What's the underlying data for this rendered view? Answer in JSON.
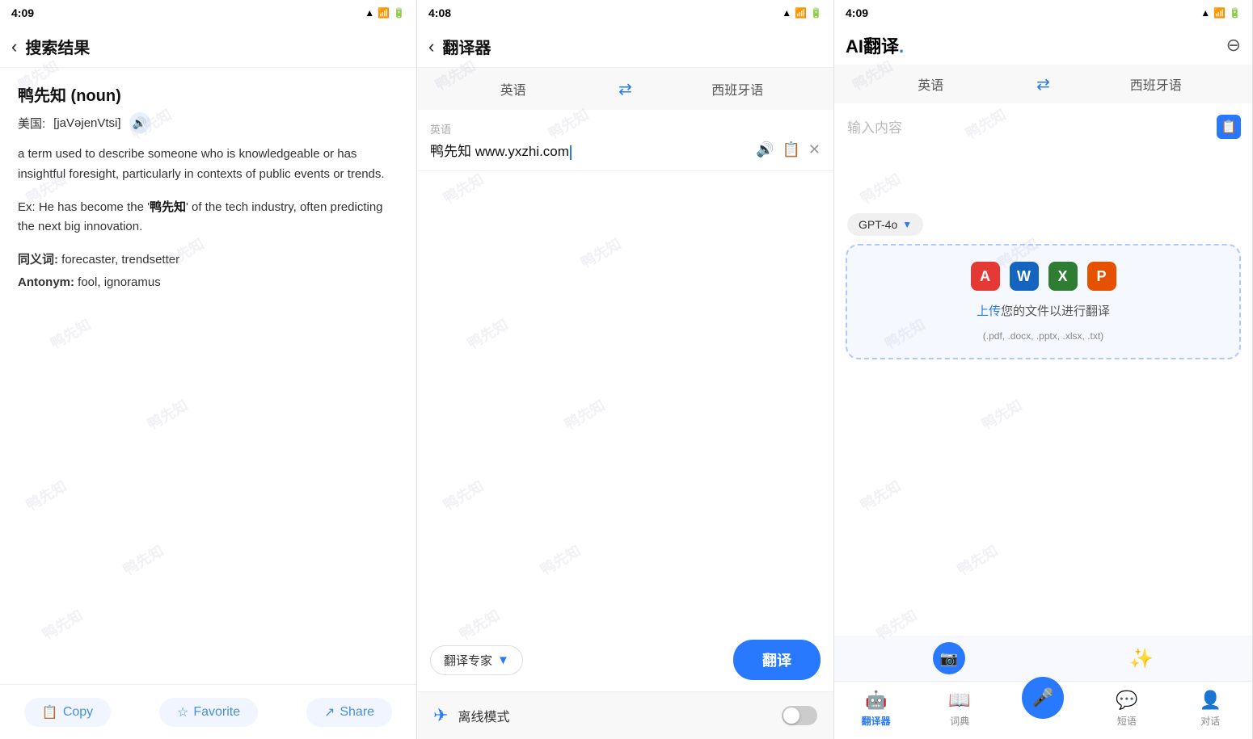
{
  "panel1": {
    "status_time": "4:09",
    "nav_back": "‹",
    "nav_title": "搜索结果",
    "word": "鸭先知 (noun)",
    "phonetic_label": "美国:",
    "phonetic": "[jaVəjenVtsi]",
    "definition": "a term used to describe someone who is knowledgeable or has insightful foresight, particularly in contexts of public events or trends.",
    "example_prefix": "Ex: He has become the '",
    "example_word": "鸭先知",
    "example_suffix": "' of the tech industry, often predicting the next big innovation.",
    "synonyms_label": "同义词:",
    "synonyms": "forecaster, trendsetter",
    "antonym_label": "Antonym:",
    "antonym": "fool, ignoramus",
    "action_copy": "Copy",
    "action_favorite": "Favorite",
    "action_share": "Share"
  },
  "panel2": {
    "status_time": "4:08",
    "nav_back": "‹",
    "nav_title": "翻译器",
    "lang_from": "英语",
    "lang_swap": "⇄",
    "lang_to": "西班牙语",
    "input_lang_label": "英语",
    "input_text": "鸭先知 www.yxzhi.com",
    "expert_label": "翻译专家",
    "translate_btn": "翻译",
    "offline_label": "离线模式"
  },
  "panel3": {
    "status_time": "4:09",
    "nav_title": "AI翻译",
    "nav_dot": ".",
    "close_icon": "⊖",
    "lang_from": "英语",
    "lang_swap": "⇄",
    "lang_to": "西班牙语",
    "placeholder": "输入内容",
    "model": "GPT-4o",
    "upload_link": "上传",
    "upload_text_mid": "您的文件以进行翻译",
    "upload_subtext": "(.pdf, .docx, .pptx, .xlsx, .txt)",
    "tabs": [
      {
        "icon": "🤖",
        "label": "翻译器",
        "active": true
      },
      {
        "icon": "📖",
        "label": "词典",
        "active": false
      },
      {
        "icon": "💬",
        "label": "短语",
        "active": false
      },
      {
        "icon": "👤",
        "label": "对话",
        "active": false
      }
    ]
  },
  "watermark": "鸭先知"
}
